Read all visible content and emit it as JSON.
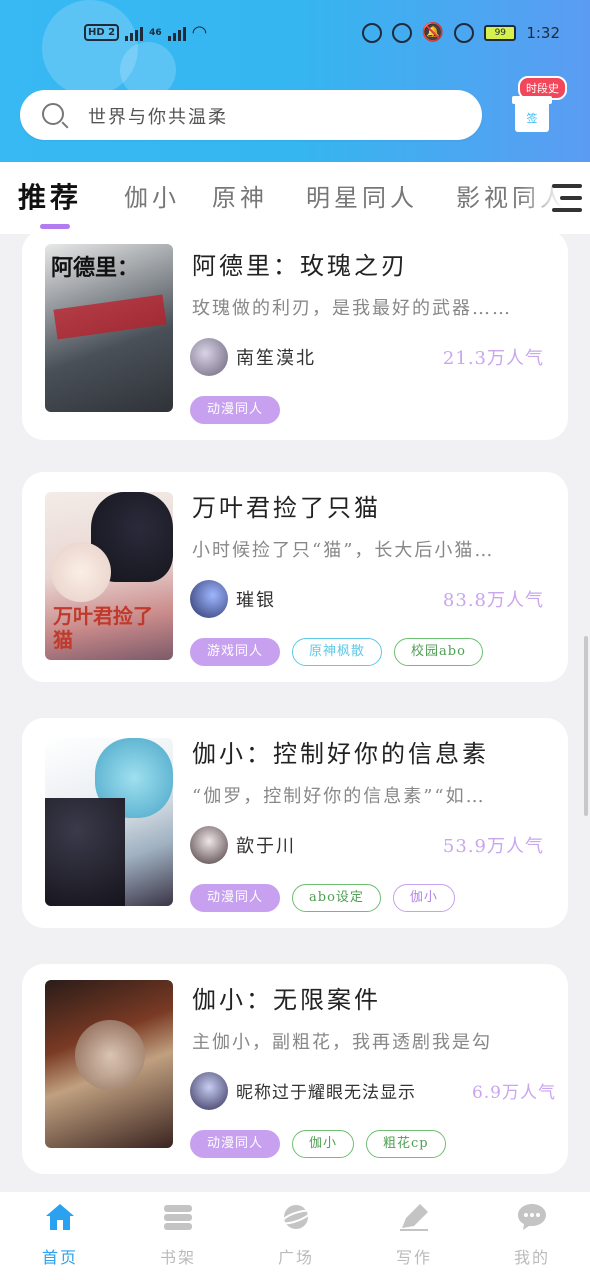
{
  "status_bar": {
    "network": "HD 2",
    "signal_4g": "46",
    "battery": "99",
    "time": "1:32"
  },
  "search": {
    "placeholder": "世界与你共温柔"
  },
  "checkin": {
    "badge": "时段史",
    "label": "签"
  },
  "tabs": [
    {
      "label": "推荐",
      "active": true
    },
    {
      "label": "伽小"
    },
    {
      "label": "原神"
    },
    {
      "label": "明星同人"
    },
    {
      "label": "影视同人"
    }
  ],
  "books": [
    {
      "cover_text": "阿德里：",
      "title": "阿德里：玫瑰之刃",
      "desc": "玫瑰做的利刃，是我最好的武器……",
      "author": "南笙漠北",
      "popularity": "21.3万人气",
      "tags": [
        {
          "label": "动漫同人",
          "style": "purple"
        }
      ]
    },
    {
      "cover_text": "万叶君捡了猫",
      "title": "万叶君捡了只猫",
      "desc": "小时候捡了只“猫”，长大后小猫…",
      "author": "璀银",
      "popularity": "83.8万人气",
      "tags": [
        {
          "label": "游戏同人",
          "style": "purple"
        },
        {
          "label": "原神枫散",
          "style": "cyan"
        },
        {
          "label": "校园abo",
          "style": "green"
        }
      ]
    },
    {
      "cover_text": "",
      "title": "伽小：控制好你的信息素",
      "desc": "“伽罗，控制好你的信息素”“如…",
      "author": "歆于川",
      "popularity": "53.9万人气",
      "tags": [
        {
          "label": "动漫同人",
          "style": "purple"
        },
        {
          "label": "abo设定",
          "style": "green"
        },
        {
          "label": "伽小",
          "style": "lilac"
        }
      ]
    },
    {
      "cover_text": "",
      "title": "伽小：无限案件",
      "desc": "主伽小，副粗花，我再透剧我是勾",
      "author": "昵称过于耀眼无法显示",
      "popularity": "6.9万人气",
      "tags": [
        {
          "label": "动漫同人",
          "style": "purple"
        },
        {
          "label": "伽小",
          "style": "green"
        },
        {
          "label": "粗花cp",
          "style": "green"
        }
      ]
    }
  ],
  "bottom_nav": [
    {
      "label": "首页",
      "icon": "home-icon",
      "active": true
    },
    {
      "label": "书架",
      "icon": "bookshelf-icon"
    },
    {
      "label": "广场",
      "icon": "planet-icon"
    },
    {
      "label": "写作",
      "icon": "pen-icon"
    },
    {
      "label": "我的",
      "icon": "chat-icon"
    }
  ],
  "colors": {
    "accent": "#2ba2ef",
    "tag_purple": "#c7a1ef",
    "popularity": "#c9a6ee"
  }
}
